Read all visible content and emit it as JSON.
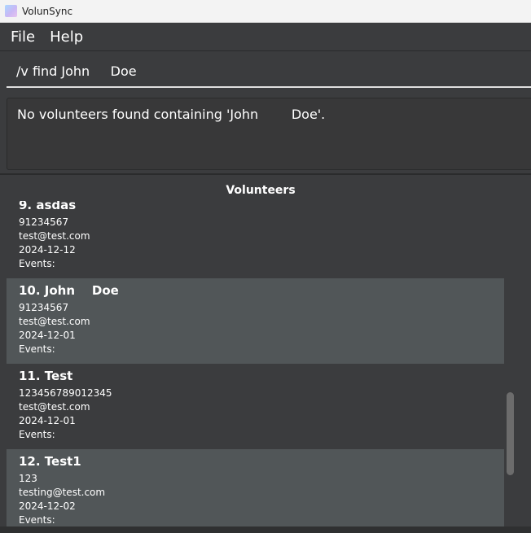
{
  "window": {
    "title": "VolunSync"
  },
  "menu": {
    "items": [
      "File",
      "Help"
    ]
  },
  "command": {
    "value": "/v find John     Doe"
  },
  "result": {
    "message": "No volunteers found containing 'John        Doe'."
  },
  "list": {
    "header": "Volunteers",
    "volunteers": [
      {
        "name": "9. asdas",
        "phone": "91234567",
        "email": "test@test.com",
        "date": "2024-12-12",
        "events": "Events:"
      },
      {
        "name": "10. John    Doe",
        "phone": "91234567",
        "email": "test@test.com",
        "date": "2024-12-01",
        "events": "Events:"
      },
      {
        "name": "11. Test",
        "phone": "123456789012345",
        "email": "test@test.com",
        "date": "2024-12-01",
        "events": "Events:"
      },
      {
        "name": "12. Test1",
        "phone": "123",
        "email": "testing@test.com",
        "date": "2024-12-02",
        "events": "Events:"
      }
    ]
  },
  "colors": {
    "background": "#3b3c3e",
    "card_alt": "#515658",
    "text": "#ffffff"
  }
}
